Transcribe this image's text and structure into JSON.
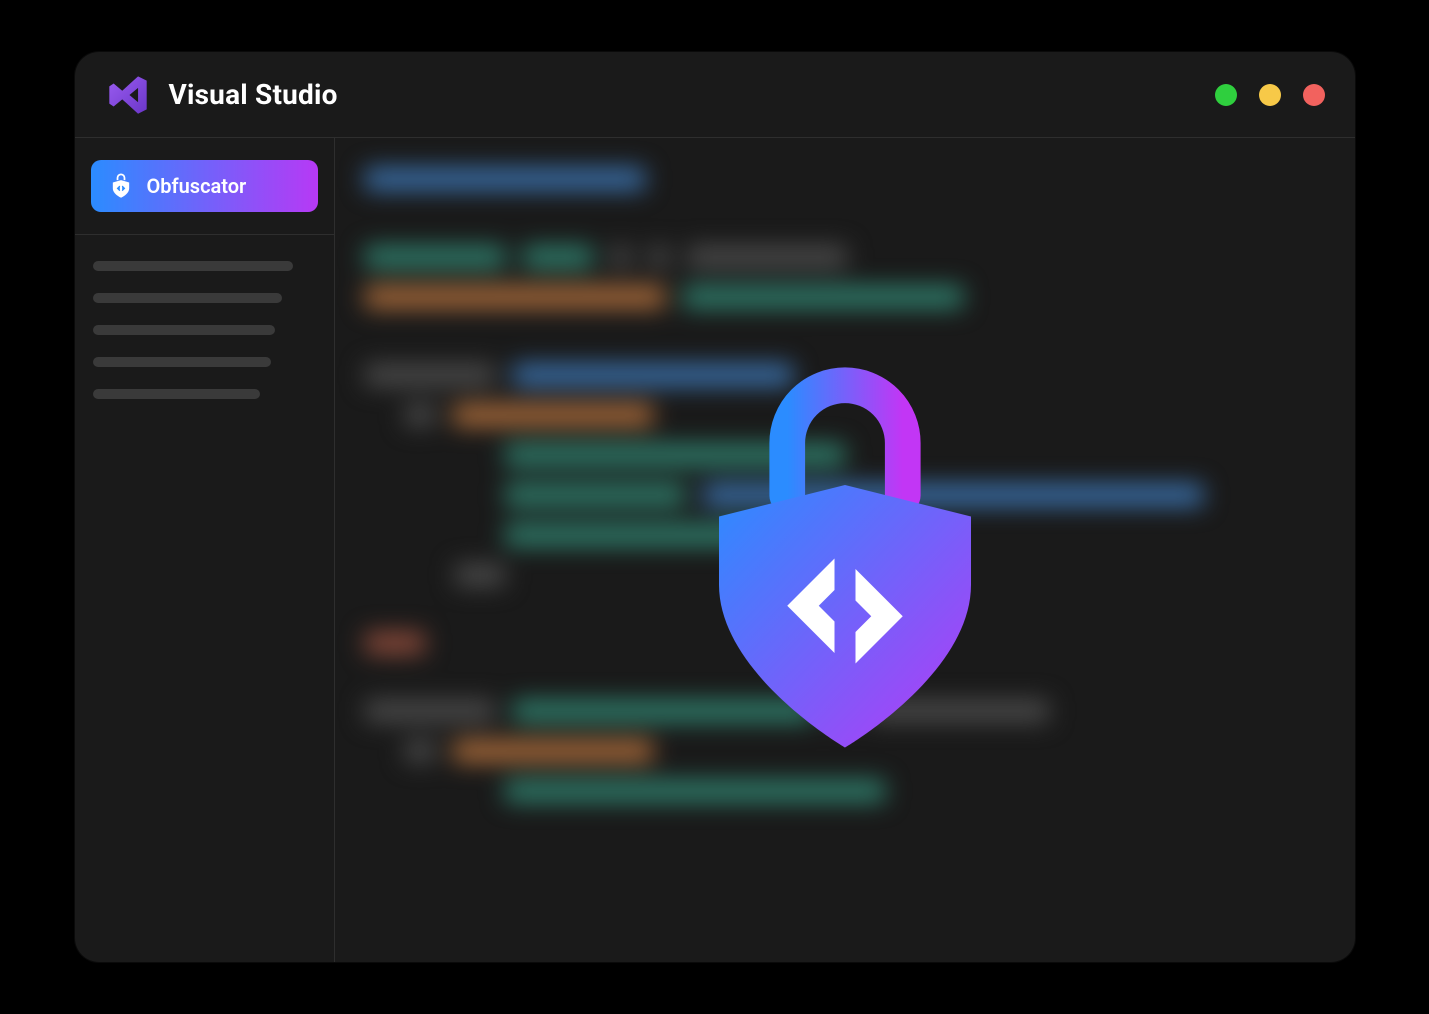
{
  "header": {
    "app_title": "Visual Studio",
    "logo_name": "visual-studio-logo"
  },
  "traffic_lights": {
    "green": "#2fcf3e",
    "yellow": "#f7c948",
    "red": "#f2625e"
  },
  "sidebar": {
    "active_item": {
      "label": "Obfuscator",
      "icon": "shield-lock-icon"
    },
    "placeholder_lines": 5
  },
  "brand_gradient": {
    "start": "#2b8cff",
    "end": "#b739f5"
  },
  "overlay": {
    "name": "shield-lock-logo",
    "colors": {
      "shackle": "#b739f5",
      "shield_gradient_start": "#2b8cff",
      "shield_gradient_end": "#b739f5",
      "glyph": "#ffffff"
    }
  }
}
